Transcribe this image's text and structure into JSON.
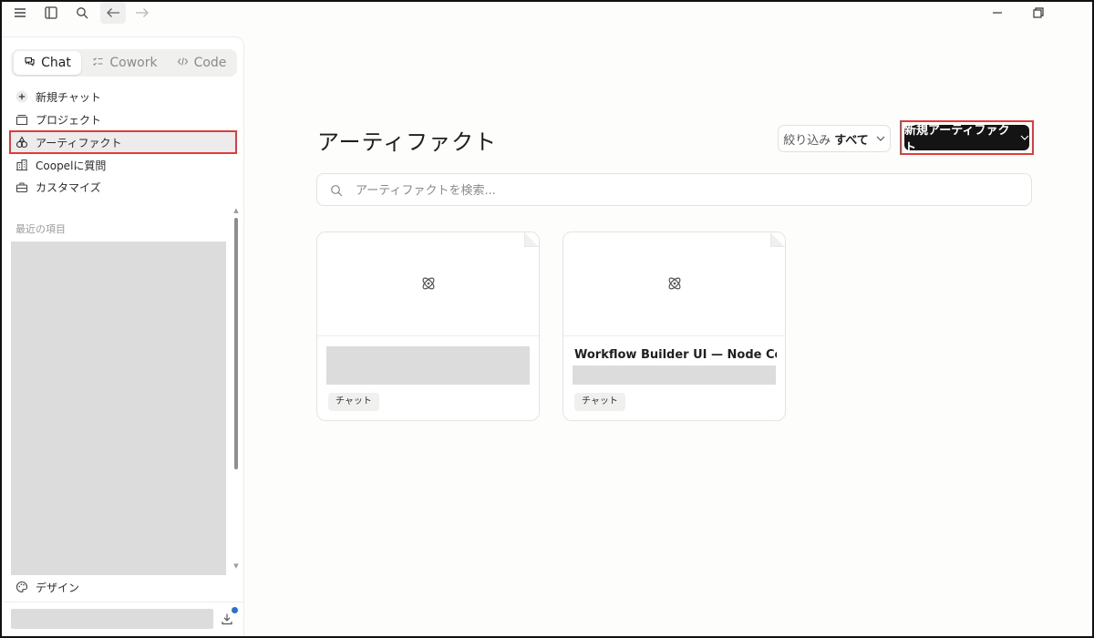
{
  "sidebar": {
    "tabs": [
      {
        "label": "Chat",
        "active": true
      },
      {
        "label": "Cowork",
        "active": false
      },
      {
        "label": "Code",
        "active": false
      }
    ],
    "nav": [
      {
        "label": "新規チャット",
        "icon": "plus-icon"
      },
      {
        "label": "プロジェクト",
        "icon": "folder-icon"
      },
      {
        "label": "アーティファクト",
        "icon": "artifacts-icon",
        "selected": true
      },
      {
        "label": "Coopelに質問",
        "icon": "building-icon"
      },
      {
        "label": "カスタマイズ",
        "icon": "briefcase-icon"
      }
    ],
    "recent_label": "最近の項目",
    "design_label": "デザイン"
  },
  "main": {
    "title": "アーティファクト",
    "filter": {
      "label": "絞り込み",
      "value": "すべて"
    },
    "new_button": "新規アーティファクト",
    "search_placeholder": "アーティファクトを検索...",
    "cards": [
      {
        "title": "",
        "tag": "チャット"
      },
      {
        "title": "Workflow Builder UI — Node Co...",
        "tag": "チャット"
      }
    ]
  },
  "colors": {
    "highlight": "#e23b3b",
    "primary_button": "#141414",
    "notification": "#2b6fd1"
  }
}
